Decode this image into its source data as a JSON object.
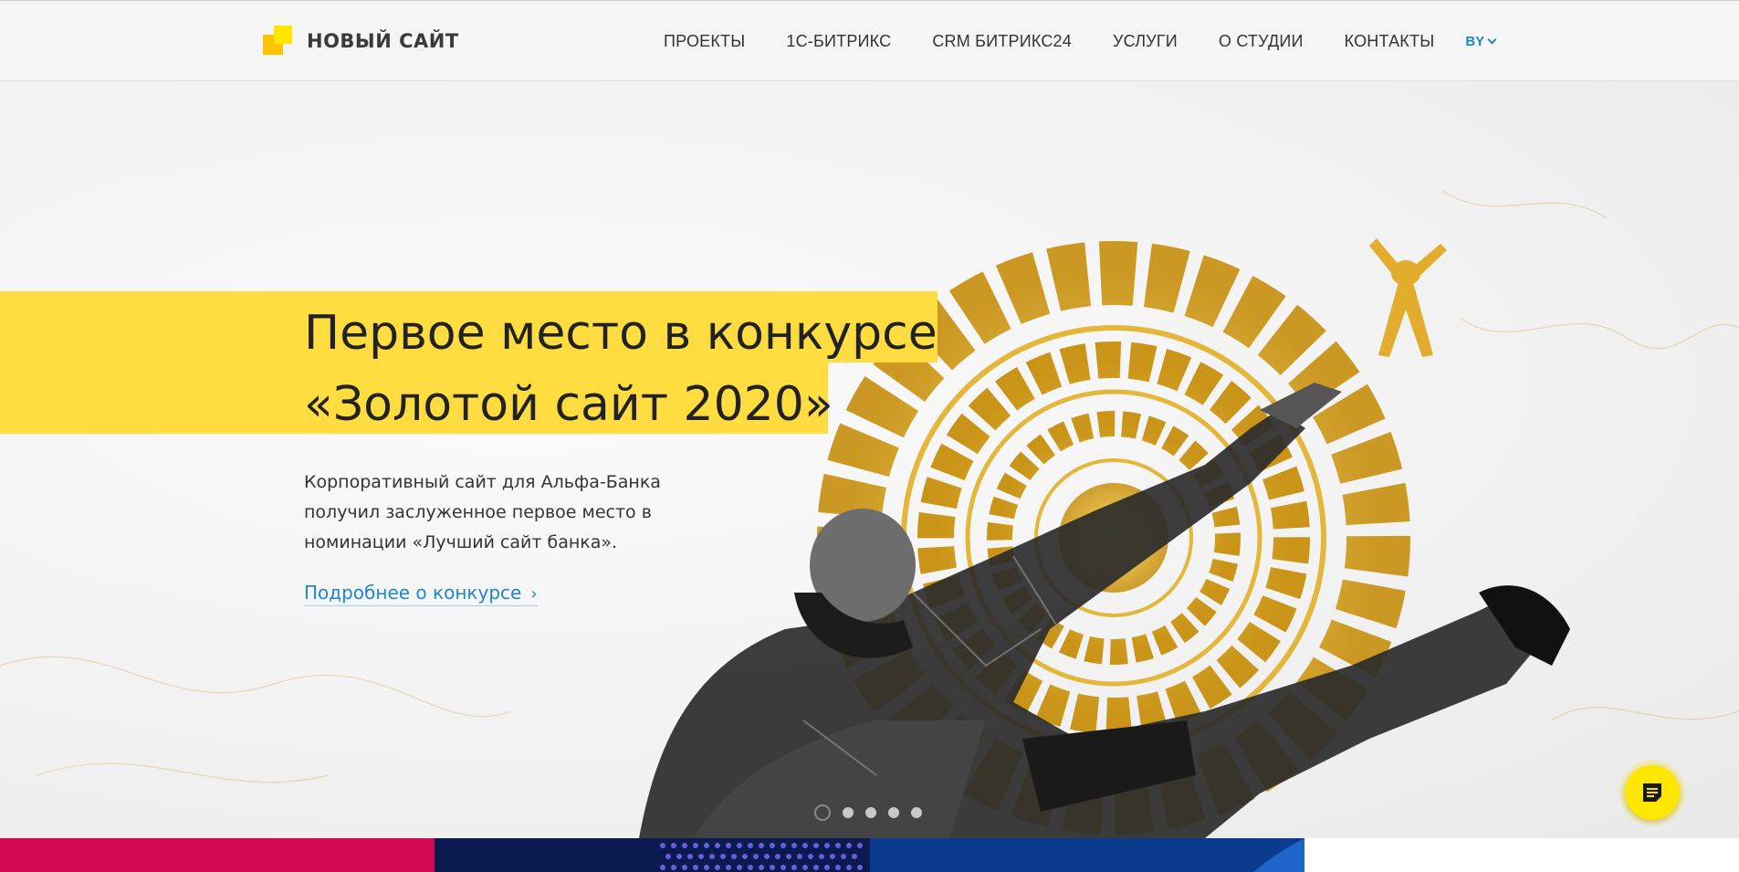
{
  "header": {
    "logo_text": "НОВЫЙ САЙТ",
    "nav": [
      {
        "label": "ПРОЕКТЫ"
      },
      {
        "label": "1С-БИТРИКС"
      },
      {
        "label": "CRM БИТРИКС24"
      },
      {
        "label": "УСЛУГИ"
      },
      {
        "label": "О СТУДИИ"
      },
      {
        "label": "КОНТАКТЫ"
      }
    ],
    "lang": "BY"
  },
  "hero": {
    "title_line1": "Первое место в конкурсе",
    "title_line2": "«Золотой сайт 2020»",
    "description": "Корпоративный сайт для Альфа-Банка получил заслуженное первое место в номинации «Лучший сайт банка».",
    "link_label": "Подробнее о конкурсе",
    "link_arrow": "›",
    "slides_count": 5,
    "active_slide": 1
  },
  "colors": {
    "accent_yellow": "#ffdd40",
    "link_blue": "#1f87c9",
    "gold": "#d9a520",
    "tile_pink": "#d10a53",
    "tile_navy": "#0c1a52",
    "tile_blue": "#0c3a8c"
  },
  "chat": {
    "icon": "chat-icon"
  }
}
